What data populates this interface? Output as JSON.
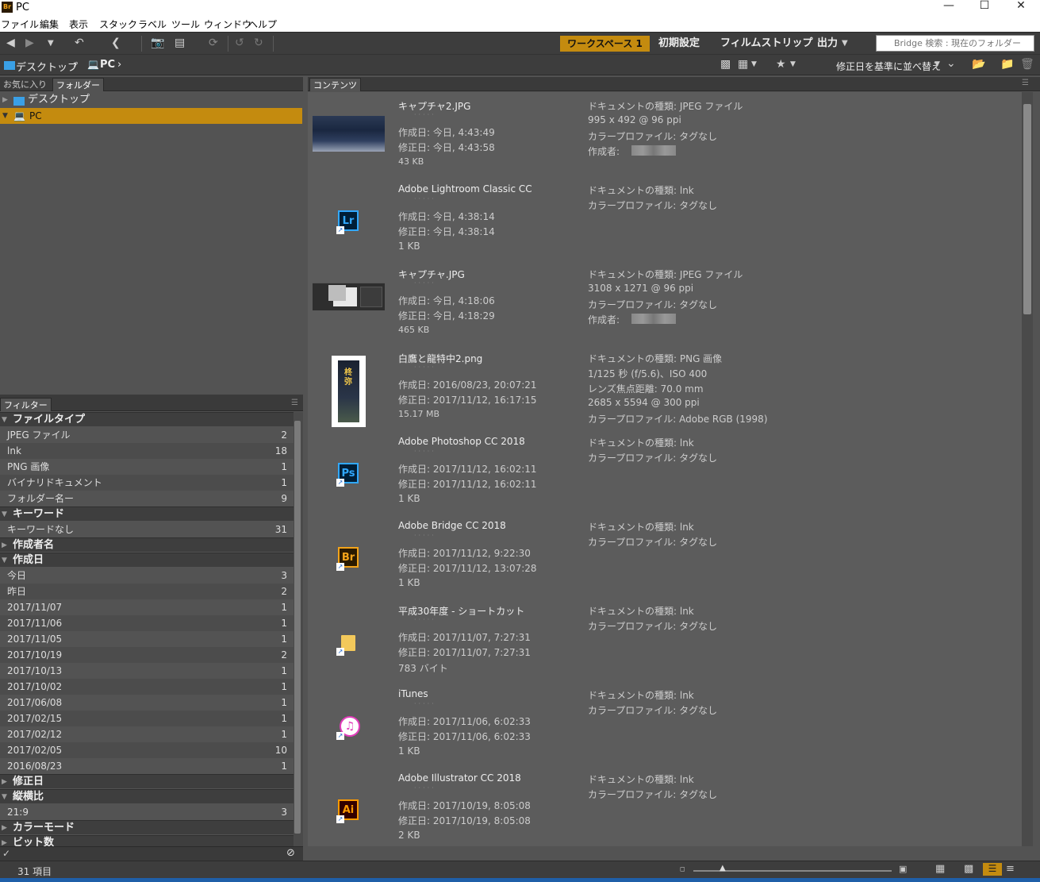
{
  "window": {
    "title": "PC",
    "app_icon": "Br"
  },
  "menu": [
    "ファイル",
    "編集",
    "表示",
    "スタック",
    "ラベル",
    "ツール",
    "ウィンドウ",
    "ヘルプ"
  ],
  "workspace": {
    "active": "ワークスペース 1",
    "tabs": [
      "初期設定",
      "フィルムストリップ",
      "出力"
    ]
  },
  "search": {
    "placeholder": "Bridge 検索 : 現在のフォルダー"
  },
  "path": {
    "items": [
      "デスクトップ",
      "PC"
    ]
  },
  "sort_label": "修正日を基準に並べ替え",
  "left_tabs": [
    "お気に入り",
    "フォルダー"
  ],
  "tree": [
    {
      "label": "デスクトップ"
    },
    {
      "label": "PC"
    }
  ],
  "filter_tab": "フィルター",
  "filters": [
    {
      "type": "cat",
      "label": "ファイルタイプ",
      "open": true
    },
    {
      "label": "JPEG ファイル",
      "count": "2"
    },
    {
      "label": "lnk",
      "count": "18"
    },
    {
      "label": "PNG 画像",
      "count": "1"
    },
    {
      "label": "バイナリドキュメント",
      "count": "1"
    },
    {
      "label": "フォルダー名ー",
      "count": "9"
    },
    {
      "type": "cat",
      "label": "キーワード",
      "open": true
    },
    {
      "label": "キーワードなし",
      "count": "31"
    },
    {
      "type": "cat",
      "label": "作成者名",
      "open": false
    },
    {
      "type": "cat",
      "label": "作成日",
      "open": true
    },
    {
      "label": "今日",
      "count": "3"
    },
    {
      "label": "昨日",
      "count": "2"
    },
    {
      "label": "2017/11/07",
      "count": "1"
    },
    {
      "label": "2017/11/06",
      "count": "1"
    },
    {
      "label": "2017/11/05",
      "count": "1"
    },
    {
      "label": "2017/10/19",
      "count": "2"
    },
    {
      "label": "2017/10/13",
      "count": "1"
    },
    {
      "label": "2017/10/02",
      "count": "1"
    },
    {
      "label": "2017/06/08",
      "count": "1"
    },
    {
      "label": "2017/02/15",
      "count": "1"
    },
    {
      "label": "2017/02/12",
      "count": "1"
    },
    {
      "label": "2017/02/05",
      "count": "10"
    },
    {
      "label": "2016/08/23",
      "count": "1"
    },
    {
      "type": "cat",
      "label": "修正日",
      "open": false
    },
    {
      "type": "cat",
      "label": "縦横比",
      "open": true
    },
    {
      "label": "21:9",
      "count": "3"
    },
    {
      "type": "cat",
      "label": "カラーモード",
      "open": false
    },
    {
      "type": "cat",
      "label": "ビット数",
      "open": false
    }
  ],
  "content_tab": "コンテンツ",
  "items": [
    {
      "name": "キャプチャ2.JPG",
      "kind": "screenshot-dark",
      "created": "作成日: 今日, 4:43:49",
      "modified": "修正日: 今日, 4:43:58",
      "size": "43 KB",
      "meta": [
        "ドキュメントの種類: JPEG ファイル",
        "995 x 492 @ 96 ppi",
        "カラープロファイル: タグなし",
        "作成者:"
      ],
      "author_blur": true
    },
    {
      "name": "Adobe Lightroom Classic CC",
      "kind": "app",
      "icon": "Lr",
      "icon_color": "#31a8ff",
      "icon_bg": "#001e36",
      "created": "作成日: 今日, 4:38:14",
      "modified": "修正日: 今日, 4:38:14",
      "size": "1 KB",
      "meta": [
        "ドキュメントの種類: lnk",
        "カラープロファイル: タグなし"
      ]
    },
    {
      "name": "キャプチャ.JPG",
      "kind": "screenshot-gray",
      "created": "作成日: 今日, 4:18:06",
      "modified": "修正日: 今日, 4:18:29",
      "size": "465 KB",
      "meta": [
        "ドキュメントの種類: JPEG ファイル",
        "3108 x 1271 @ 96 ppi",
        "カラープロファイル: タグなし",
        "作成者:"
      ],
      "author_blur": true
    },
    {
      "name": "白鷹と龍特中2.png",
      "kind": "banner",
      "banner_text": "柊弥",
      "created": "作成日: 2016/08/23, 20:07:21",
      "modified": "修正日: 2017/11/12, 16:17:15",
      "size": "15.17 MB",
      "meta": [
        "ドキュメントの種類: PNG 画像",
        "1/125 秒 (f/5.6)、ISO 400",
        "レンズ焦点距離: 70.0 mm",
        "2685 x 5594 @ 300 ppi",
        "カラープロファイル: Adobe RGB (1998)"
      ]
    },
    {
      "name": "Adobe Photoshop CC 2018",
      "kind": "app",
      "icon": "Ps",
      "icon_color": "#31a8ff",
      "icon_bg": "#001e36",
      "created": "作成日: 2017/11/12, 16:02:11",
      "modified": "修正日: 2017/11/12, 16:02:11",
      "size": "1 KB",
      "meta": [
        "ドキュメントの種類: lnk",
        "カラープロファイル: タグなし"
      ]
    },
    {
      "name": "Adobe Bridge CC 2018",
      "kind": "app",
      "icon": "Br",
      "icon_color": "#f2a31a",
      "icon_bg": "#2a1a00",
      "created": "作成日: 2017/11/12, 9:22:30",
      "modified": "修正日: 2017/11/12, 13:07:28",
      "size": "1 KB",
      "meta": [
        "ドキュメントの種類: lnk",
        "カラープロファイル: タグなし"
      ]
    },
    {
      "name": "平成30年度 - ショートカット",
      "kind": "folder",
      "created": "作成日: 2017/11/07, 7:27:31",
      "modified": "修正日: 2017/11/07, 7:27:31",
      "size": "783 バイト",
      "meta": [
        "ドキュメントの種類: lnk",
        "カラープロファイル: タグなし"
      ]
    },
    {
      "name": "iTunes",
      "kind": "itunes",
      "created": "作成日: 2017/11/06, 6:02:33",
      "modified": "修正日: 2017/11/06, 6:02:33",
      "size": "1 KB",
      "meta": [
        "ドキュメントの種類: lnk",
        "カラープロファイル: タグなし"
      ]
    },
    {
      "name": "Adobe Illustrator CC 2018",
      "kind": "app",
      "icon": "Ai",
      "icon_color": "#ff9a00",
      "icon_bg": "#330000",
      "created": "作成日: 2017/10/19, 8:05:08",
      "modified": "修正日: 2017/10/19, 8:05:08",
      "size": "2 KB",
      "meta": [
        "ドキュメントの種類: lnk",
        "カラープロファイル: タグなし"
      ]
    }
  ],
  "status": {
    "count": "31 項目"
  },
  "colors": {
    "accent": "#c48b0f",
    "panel": "#535353",
    "content_bg": "#5c5c5c",
    "taskbar": "#1f5fa8"
  }
}
